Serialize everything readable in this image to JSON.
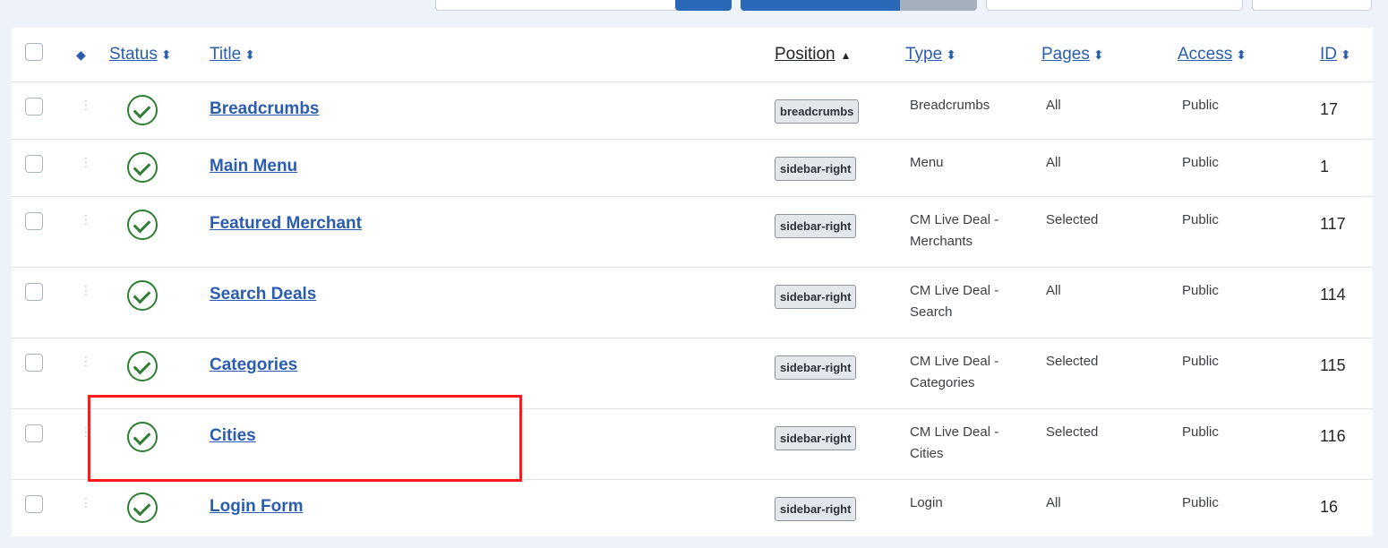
{
  "header": {
    "columns": [
      {
        "key": "status",
        "label": "Status"
      },
      {
        "key": "title",
        "label": "Title"
      },
      {
        "key": "position",
        "label": "Position"
      },
      {
        "key": "type",
        "label": "Type"
      },
      {
        "key": "pages",
        "label": "Pages"
      },
      {
        "key": "access",
        "label": "Access"
      },
      {
        "key": "id",
        "label": "ID"
      }
    ]
  },
  "rows": [
    {
      "title": "Breadcrumbs",
      "position": "breadcrumbs",
      "type": "Breadcrumbs",
      "pages": "All",
      "access": "Public",
      "id": "17"
    },
    {
      "title": "Main Menu",
      "position": "sidebar-right",
      "type": "Menu",
      "pages": "All",
      "access": "Public",
      "id": "1"
    },
    {
      "title": "Featured Merchant",
      "position": "sidebar-right",
      "type": "CM Live Deal - Merchants",
      "pages": "Selected",
      "access": "Public",
      "id": "117"
    },
    {
      "title": "Search Deals",
      "position": "sidebar-right",
      "type": "CM Live Deal - Search",
      "pages": "All",
      "access": "Public",
      "id": "114"
    },
    {
      "title": "Categories",
      "position": "sidebar-right",
      "type": "CM Live Deal - Categories",
      "pages": "Selected",
      "access": "Public",
      "id": "115"
    },
    {
      "title": "Cities",
      "position": "sidebar-right",
      "type": "CM Live Deal - Cities",
      "pages": "Selected",
      "access": "Public",
      "id": "116"
    },
    {
      "title": "Login Form",
      "position": "sidebar-right",
      "type": "Login",
      "pages": "All",
      "access": "Public",
      "id": "16"
    }
  ],
  "colors": {
    "link": "#2a5db0",
    "status_published": "#2e7d32",
    "highlight": "#ff1a1a"
  }
}
